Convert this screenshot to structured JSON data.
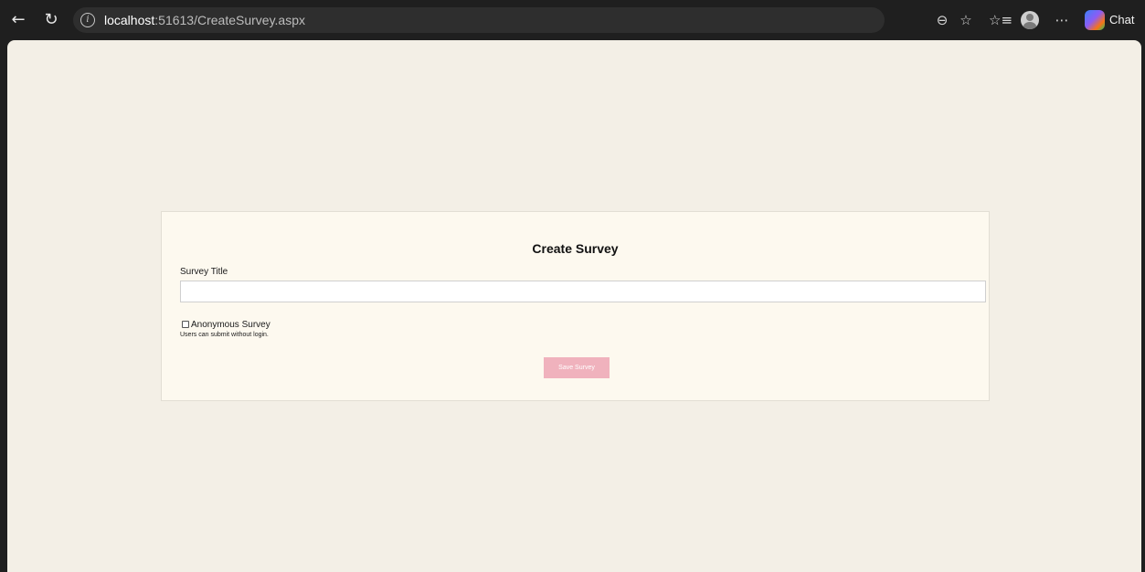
{
  "browser": {
    "url_host": "localhost",
    "url_rest": ":51613/CreateSurvey.aspx",
    "chat_label": "Chat",
    "icons": {
      "back": "back-arrow-icon",
      "refresh": "refresh-icon",
      "info": "info-icon",
      "zoom": "zoom-out-icon",
      "favorite": "star-icon",
      "favorites_list": "favorites-list-icon",
      "profile": "profile-avatar-icon",
      "more": "more-options-icon",
      "copilot": "copilot-icon"
    }
  },
  "form": {
    "title": "Create Survey",
    "survey_title_label": "Survey Title",
    "survey_title_value": "",
    "anonymous_label": "Anonymous Survey",
    "anonymous_checked": false,
    "anonymous_help": "Users can submit without login.",
    "save_label": "Save Survey"
  },
  "colors": {
    "page_background": "#f3efe6",
    "card_background": "#fdf9ef",
    "save_button": "#f0b2bd",
    "browser_chrome": "#1f1f1f"
  }
}
